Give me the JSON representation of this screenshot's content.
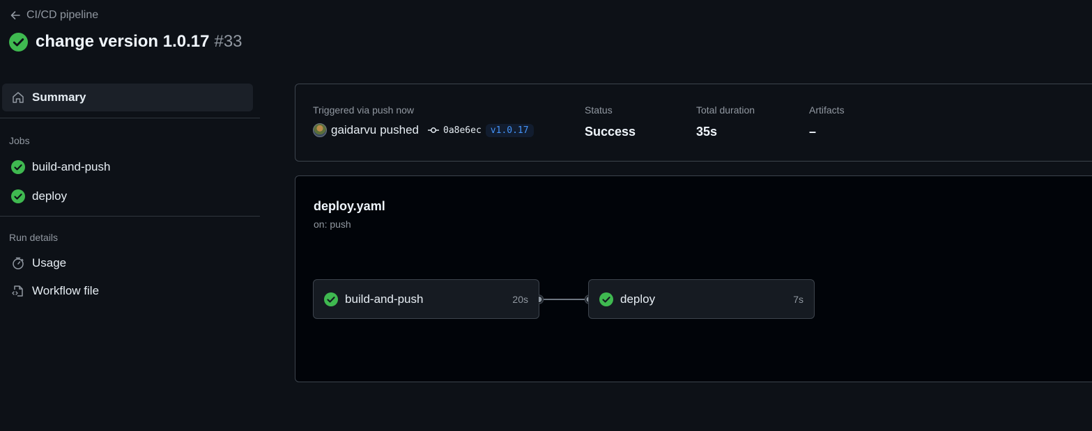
{
  "header": {
    "back_label": "CI/CD pipeline",
    "title": "change version 1.0.17",
    "run_number": "#33"
  },
  "sidebar": {
    "summary_label": "Summary",
    "jobs_section": "Jobs",
    "jobs": [
      {
        "label": "build-and-push",
        "status": "success"
      },
      {
        "label": "deploy",
        "status": "success"
      }
    ],
    "run_details_section": "Run details",
    "usage_label": "Usage",
    "workflow_file_label": "Workflow file"
  },
  "summary": {
    "triggered_label": "Triggered via push now",
    "user": "gaidarvu",
    "action": "pushed",
    "commit_sha": "0a8e6ec",
    "tag": "v1.0.17",
    "status_label": "Status",
    "status_value": "Success",
    "duration_label": "Total duration",
    "duration_value": "35s",
    "artifacts_label": "Artifacts",
    "artifacts_value": "–"
  },
  "workflow": {
    "file": "deploy.yaml",
    "trigger": "on: push",
    "jobs": [
      {
        "name": "build-and-push",
        "time": "20s"
      },
      {
        "name": "deploy",
        "time": "7s"
      }
    ]
  },
  "colors": {
    "background": "#0d1117",
    "success": "#3fb950",
    "accent": "#4493f8",
    "border": "#3d444d"
  }
}
